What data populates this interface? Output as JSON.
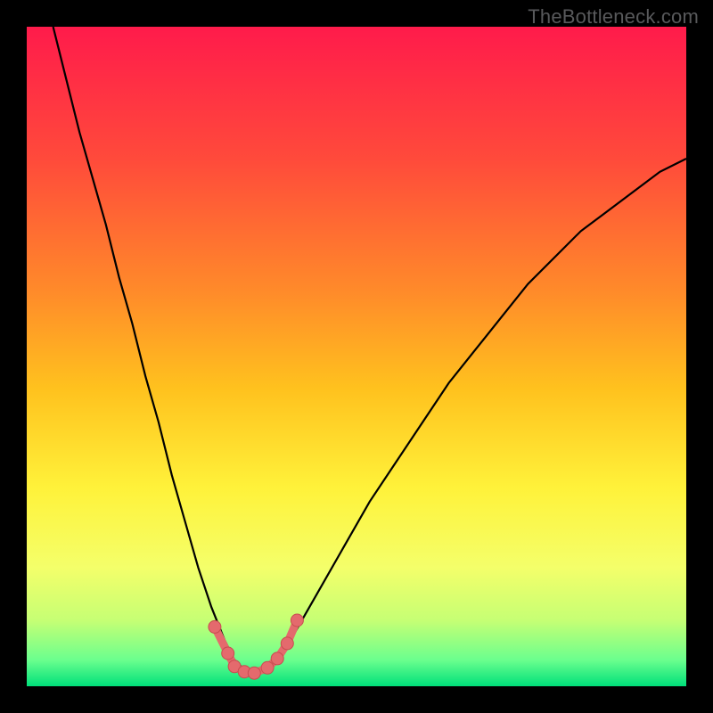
{
  "watermark": {
    "text": "TheBottleneck.com"
  },
  "colors": {
    "frame_bg": "#000000",
    "watermark": "#58595b",
    "curve": "#000000",
    "markers_fill": "#e46a6d",
    "markers_stroke": "#c94c50",
    "gradient_stops": [
      {
        "offset": 0.0,
        "color": "#ff1b4b"
      },
      {
        "offset": 0.2,
        "color": "#ff4a3b"
      },
      {
        "offset": 0.4,
        "color": "#ff8a2a"
      },
      {
        "offset": 0.55,
        "color": "#ffc21e"
      },
      {
        "offset": 0.7,
        "color": "#fff23a"
      },
      {
        "offset": 0.82,
        "color": "#f4ff6a"
      },
      {
        "offset": 0.9,
        "color": "#c6ff74"
      },
      {
        "offset": 0.96,
        "color": "#6bff8e"
      },
      {
        "offset": 1.0,
        "color": "#00e07a"
      }
    ]
  },
  "chart_data": {
    "type": "line",
    "title": "",
    "xlabel": "",
    "ylabel": "",
    "xlim": [
      0,
      100
    ],
    "ylim": [
      0,
      100
    ],
    "series": [
      {
        "name": "bottleneck-curve",
        "x": [
          4,
          6,
          8,
          10,
          12,
          14,
          16,
          18,
          20,
          22,
          24,
          26,
          28,
          30,
          31.5,
          33,
          34.5,
          36,
          38,
          40,
          44,
          48,
          52,
          56,
          60,
          64,
          68,
          72,
          76,
          80,
          84,
          88,
          92,
          96,
          100
        ],
        "y": [
          100,
          92,
          84,
          77,
          70,
          62,
          55,
          47,
          40,
          32,
          25,
          18,
          12,
          7,
          4,
          2.5,
          2,
          2.5,
          4,
          7,
          14,
          21,
          28,
          34,
          40,
          46,
          51,
          56,
          61,
          65,
          69,
          72,
          75,
          78,
          80
        ]
      }
    ],
    "markers": {
      "name": "highlight-points",
      "points": [
        {
          "x": 28.5,
          "y": 9
        },
        {
          "x": 30.5,
          "y": 5
        },
        {
          "x": 31.5,
          "y": 3
        },
        {
          "x": 33.0,
          "y": 2.2
        },
        {
          "x": 34.5,
          "y": 2
        },
        {
          "x": 36.5,
          "y": 2.8
        },
        {
          "x": 38.0,
          "y": 4.2
        },
        {
          "x": 39.5,
          "y": 6.5
        },
        {
          "x": 41.0,
          "y": 10
        }
      ]
    },
    "grid": false,
    "legend": false
  }
}
